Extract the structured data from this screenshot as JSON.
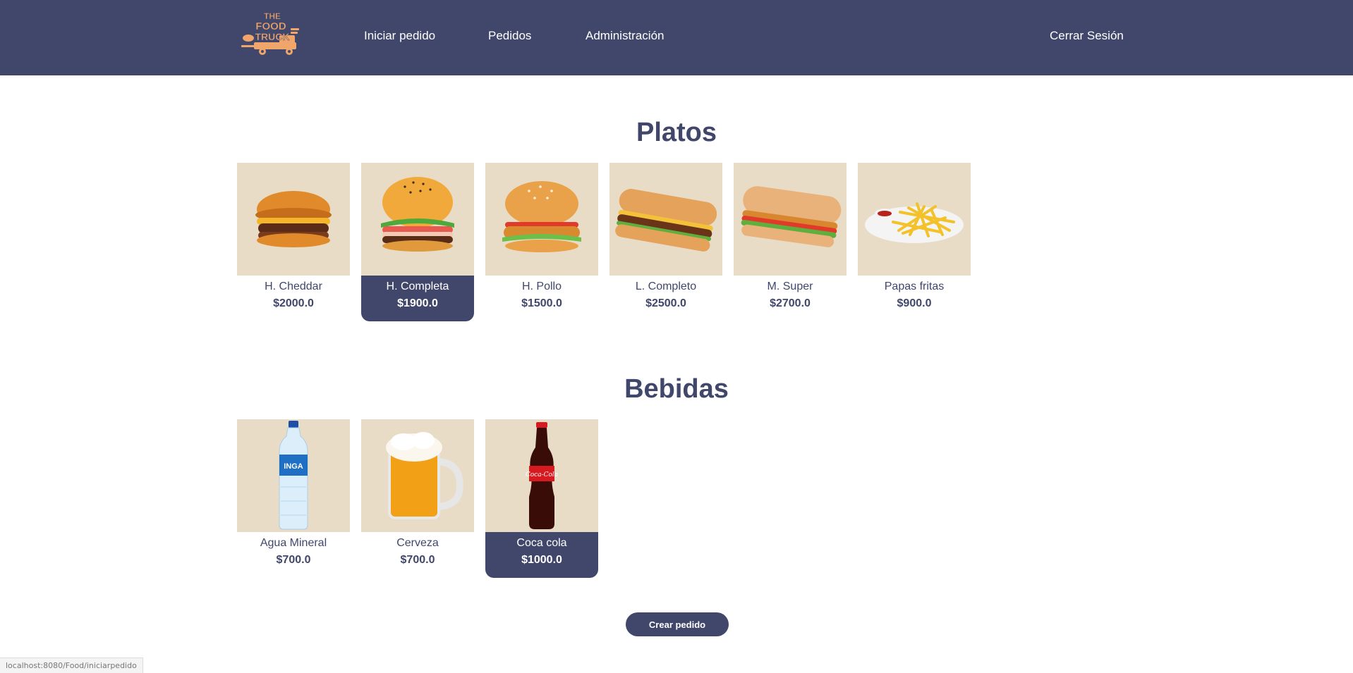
{
  "nav": {
    "logo_text": [
      "THE",
      "FOOD",
      "TRUCK"
    ],
    "links": [
      "Iniciar pedido",
      "Pedidos",
      "Administración"
    ],
    "logout": "Cerrar Sesión"
  },
  "sections": {
    "platos": {
      "title": "Platos",
      "items": [
        {
          "name": "H. Cheddar",
          "price": "$2000.0",
          "icon": "burger-cheddar-photo",
          "selected": false
        },
        {
          "name": "H. Completa",
          "price": "$1900.0",
          "icon": "burger-completa-photo",
          "selected": true
        },
        {
          "name": "H. Pollo",
          "price": "$1500.0",
          "icon": "burger-pollo-photo",
          "selected": false
        },
        {
          "name": "L. Completo",
          "price": "$2500.0",
          "icon": "lomito-completo-photo",
          "selected": false
        },
        {
          "name": "M. Super",
          "price": "$2700.0",
          "icon": "milanesa-super-photo",
          "selected": false
        },
        {
          "name": "Papas fritas",
          "price": "$900.0",
          "icon": "fries-photo",
          "selected": false
        }
      ]
    },
    "bebidas": {
      "title": "Bebidas",
      "items": [
        {
          "name": "Agua Mineral",
          "price": "$700.0",
          "icon": "water-bottle-photo",
          "selected": false,
          "label": "INGA"
        },
        {
          "name": "Cerveza",
          "price": "$700.0",
          "icon": "beer-mug-photo",
          "selected": false
        },
        {
          "name": "Coca cola",
          "price": "$1000.0",
          "icon": "coca-cola-bottle-photo",
          "selected": true,
          "label": "Coca-Cola"
        }
      ]
    }
  },
  "actions": {
    "create_order": "Crear pedido"
  },
  "status_bar": {
    "url": "localhost:8080/Food/iniciarpedido"
  },
  "colors": {
    "header": "#41476b",
    "accent": "#41476b",
    "card_bg": "#e8dcc6",
    "logo": "#f0a56b"
  }
}
